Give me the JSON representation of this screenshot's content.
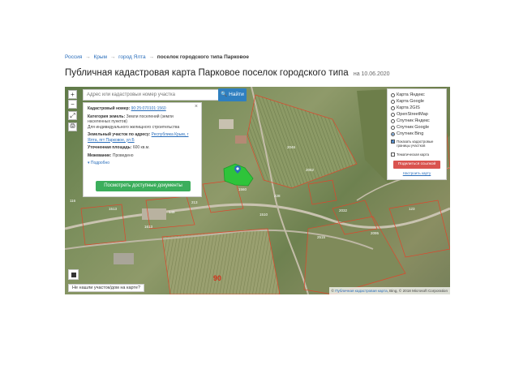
{
  "breadcrumb": {
    "items": [
      "Россия",
      "Крым",
      "город Ялта"
    ],
    "current": "поселок городского типа Парковое",
    "separator": "→"
  },
  "page": {
    "title": "Публичная кадастровая карта Парковое поселок городского типа",
    "date": "на 10.06.2020"
  },
  "search": {
    "placeholder": "Адрес или кадастровый номер участка",
    "button_label": "Найти"
  },
  "tools": [
    "+",
    "−",
    "⤢",
    "🖨"
  ],
  "info": {
    "close": "×",
    "cadastral_label": "Кадастровый номер:",
    "cadastral_value": "90:25:070101:1560",
    "category_label": "Категория земель:",
    "category_value": "Земли поселений (земли населенных пунктов)",
    "usage_value": "Для индивидуального жилищного строительства",
    "address_label": "Земельный участок по адресу:",
    "address_value": "Республика Крым, г Ялта, пгт Парковое, ул Б",
    "area_label": "Уточненная площадь:",
    "area_value": "600 кв.м.",
    "ownership_label": "Межевание:",
    "ownership_value": "Проведено",
    "more_link": "▾ Подробно",
    "docs_button": "Посмотреть доступные документы"
  },
  "layers": {
    "options": [
      {
        "label": "Карта Яндекс",
        "selected": false
      },
      {
        "label": "Карта Google",
        "selected": false
      },
      {
        "label": "Карта 2GIS",
        "selected": false
      },
      {
        "label": "OpenStreetMap",
        "selected": false
      },
      {
        "label": "Спутник Яндекс",
        "selected": false
      },
      {
        "label": "Спутник Google",
        "selected": false
      },
      {
        "label": "Спутник Bing",
        "selected": true
      }
    ],
    "show_borders_label": "Показать кадастровые границы участков",
    "show_borders_checked": true,
    "thematic_label": "Тематическая карта",
    "thematic_checked": false,
    "share_button": "Поделиться ссылкой",
    "configure_link": "Настроить карту"
  },
  "map": {
    "attribution_icon": "©",
    "attribution_link": "Публичная кадастровая карта",
    "attribution_rest": ", Bing, © 2018 Microsoft Corporation",
    "not_found": "Не нашли участок/дом на карте?",
    "big_label": "90",
    "parcel_labels": [
      "2046",
      "2052",
      "1613",
      "228",
      "2032",
      "2515",
      "1510",
      "2095",
      "149",
      "213",
      "116",
      "123",
      "1513",
      "1560"
    ]
  },
  "colors": {
    "accent": "#2f7fc0",
    "docs_button": "#3cae5c",
    "share_button": "#d9534f",
    "selected_parcel": "#2ec43a",
    "parcel_border": "#e0452b"
  }
}
